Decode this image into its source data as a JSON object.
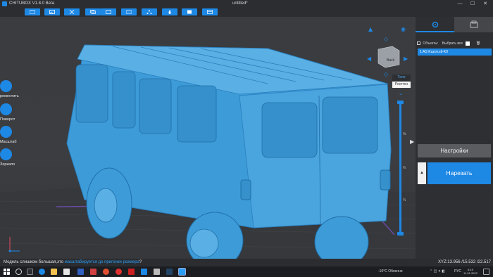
{
  "window": {
    "app_title": "CHITUBOX V1.8.0 Beta",
    "doc_title": "untitled*",
    "minimize": "—",
    "maximize": "☐",
    "close": "✕"
  },
  "toolbar": {
    "buttons": [
      {
        "icon": "open-file-icon"
      },
      {
        "icon": "image-icon"
      },
      {
        "icon": "cut-icon"
      },
      {
        "icon": "copy-icon"
      },
      {
        "icon": "layout-icon"
      },
      {
        "icon": "network-icon"
      },
      {
        "icon": "drop-icon"
      },
      {
        "icon": "frame-icon"
      },
      {
        "icon": "box-icon"
      }
    ]
  },
  "left_tools": [
    {
      "label": "реместить",
      "icon": "move-icon"
    },
    {
      "label": "Поворот",
      "icon": "rotate-icon"
    },
    {
      "label": "Масштаб",
      "icon": "scale-icon"
    },
    {
      "label": "Зеркало",
      "icon": "mirror-icon"
    }
  ],
  "navcube": {
    "face": "Back"
  },
  "view_modes": {
    "solid": "Тело",
    "xray": "Рентген"
  },
  "layer_slider": {
    "top_mark": "⅛",
    "mid_mark": "½",
    "low_mark": "¼"
  },
  "right_panel": {
    "objects_label": "Объекты:",
    "select_all_label": "Выбрать все",
    "object_item": "1:AS Kuzov.stl-K0",
    "settings_button": "Настройки",
    "slice_button": "Нарезать",
    "slice_side": "▲"
  },
  "status": {
    "message_prefix": "Модель слишком большая,это ",
    "message_link": "масштабируется до пригонки размера",
    "message_suffix": "?",
    "coordinates": "XYZ:13.956 /15.532 /22.517"
  },
  "taskbar": {
    "weather": "-10°C  Облачно",
    "lang": "РУС",
    "time": "6:19",
    "date": "11.01.2022"
  },
  "colors": {
    "accent": "#1e88e5",
    "model": "#3d9bd8",
    "background": "#2d2f33"
  }
}
